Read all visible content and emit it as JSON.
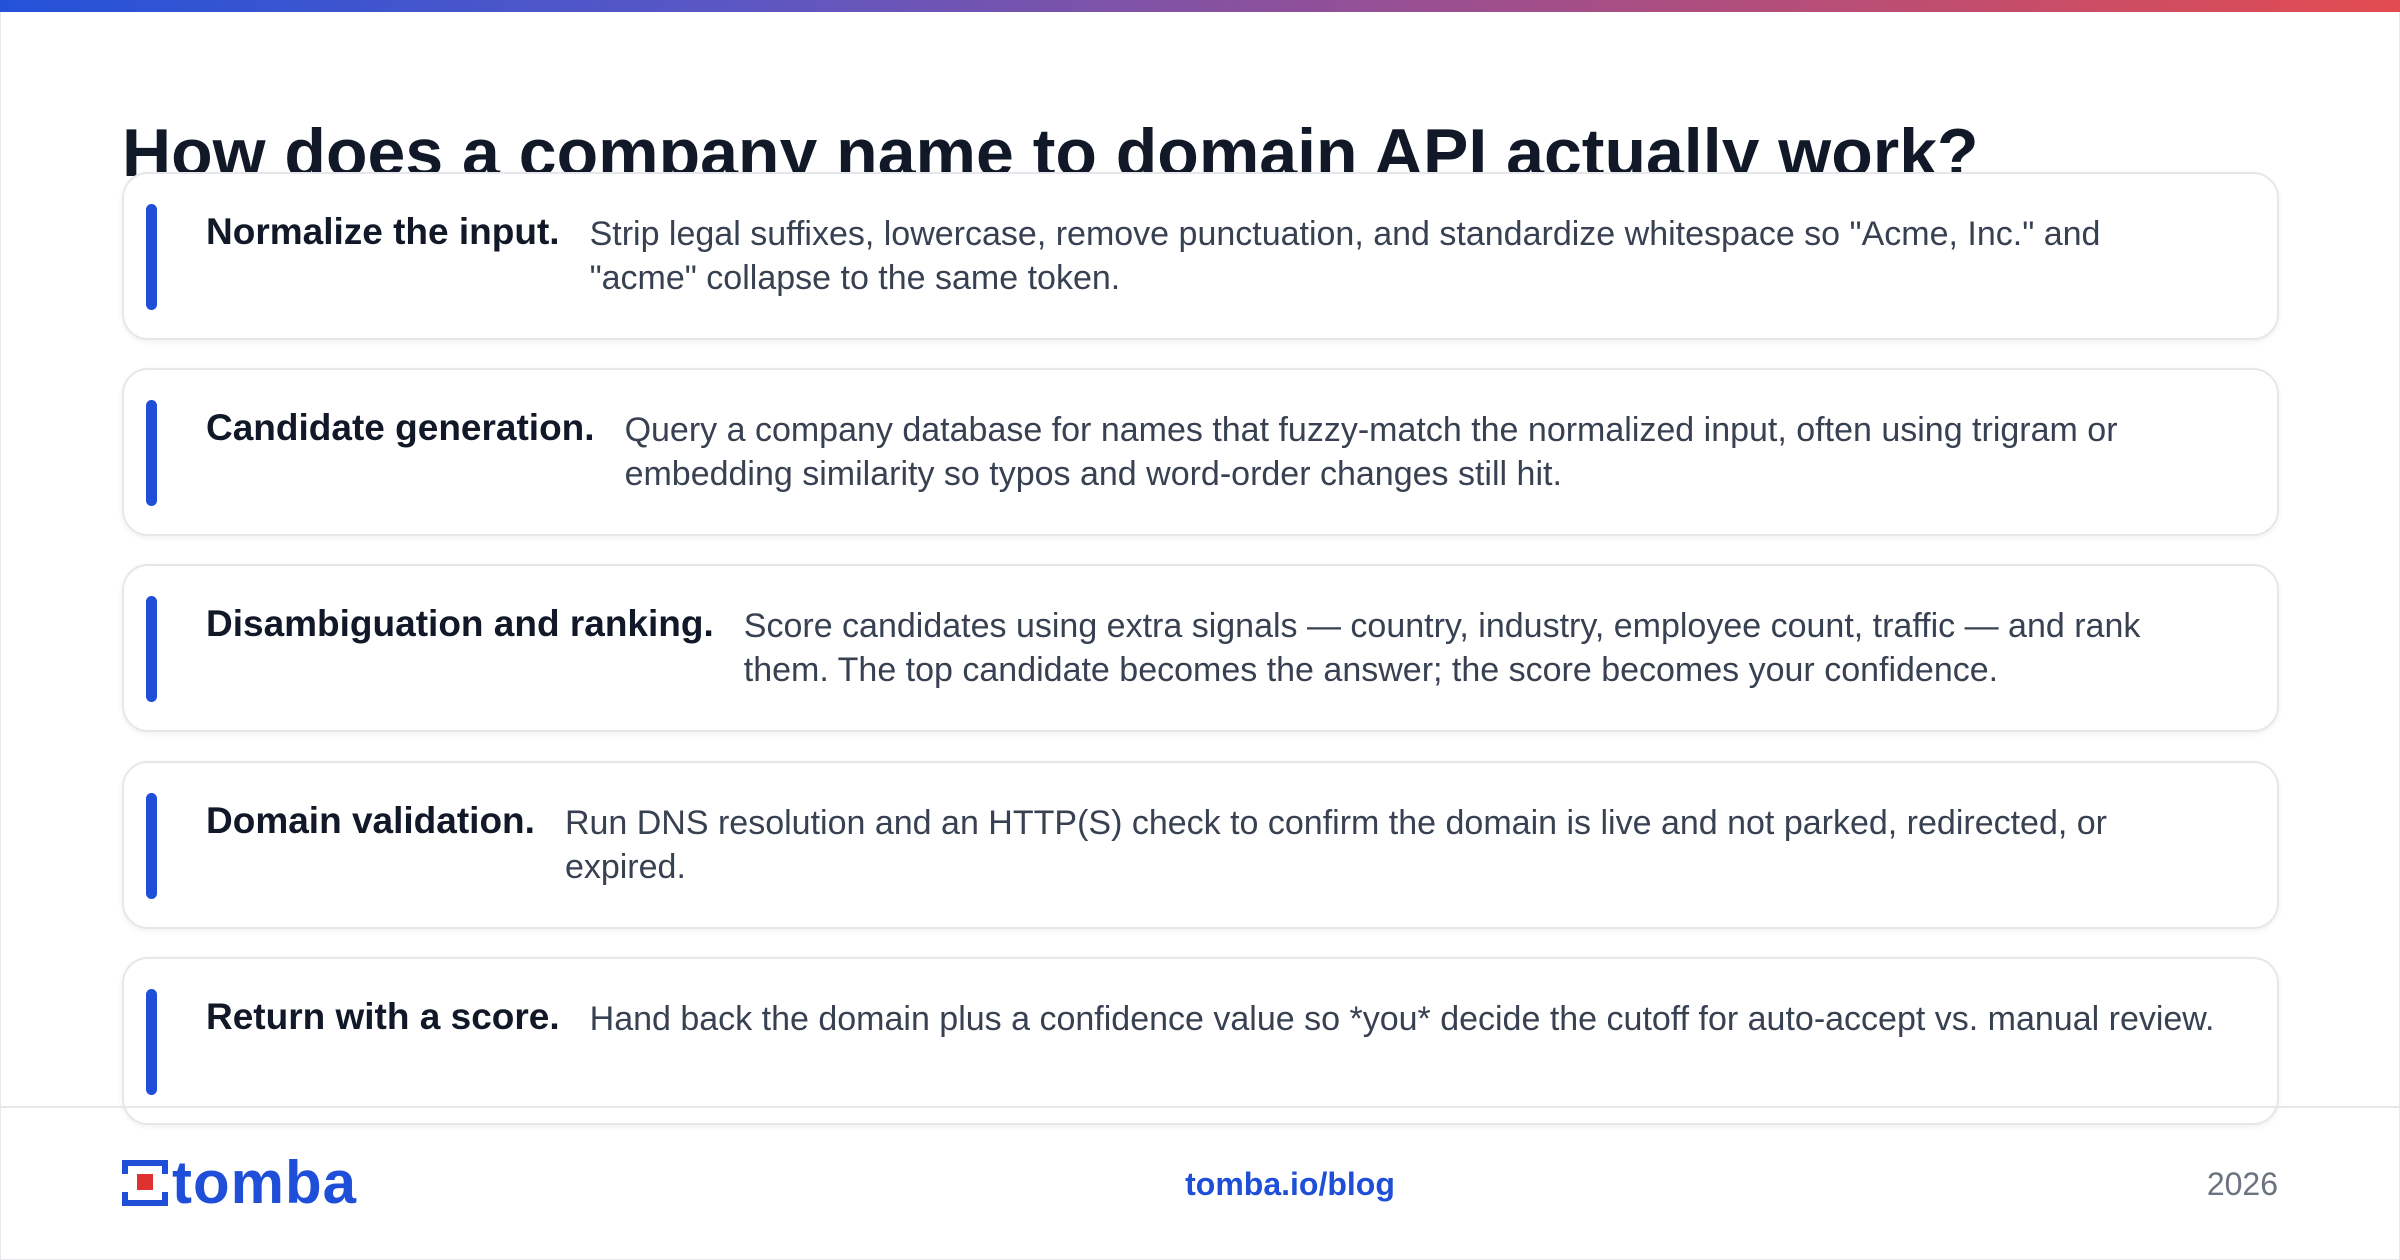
{
  "title": "How does a company name to domain API actually work?",
  "steps": [
    {
      "heading": "Normalize the input.",
      "description": "Strip legal suffixes, lowercase, remove punctuation, and standardize whitespace so \"Acme, Inc.\" and \"acme\" collapse to the same token."
    },
    {
      "heading": "Candidate generation.",
      "description": "Query a company database for names that fuzzy-match the normalized input, often using trigram or embedding similarity so typos and word-order changes still hit."
    },
    {
      "heading": "Disambiguation and ranking.",
      "description": "Score candidates using extra signals — country, industry, employee count, traffic — and rank them. The top candidate becomes the answer; the score becomes your confidence."
    },
    {
      "heading": "Domain validation.",
      "description": "Run DNS resolution and an HTTP(S) check to confirm the domain is live and not parked, redirected, or expired."
    },
    {
      "heading": "Return with a score.",
      "description": "Hand back the domain plus a confidence value so *you* decide the cutoff for auto-accept vs. manual review."
    }
  ],
  "footer": {
    "logo_text": "tomba",
    "logo_icon": "tomba-logo-icon",
    "link": "tomba.io/blog",
    "year": "2026"
  },
  "colors": {
    "accent": "#1f4fd8",
    "logo_red": "#e03131",
    "heading": "#111827",
    "body_text": "#374151"
  }
}
